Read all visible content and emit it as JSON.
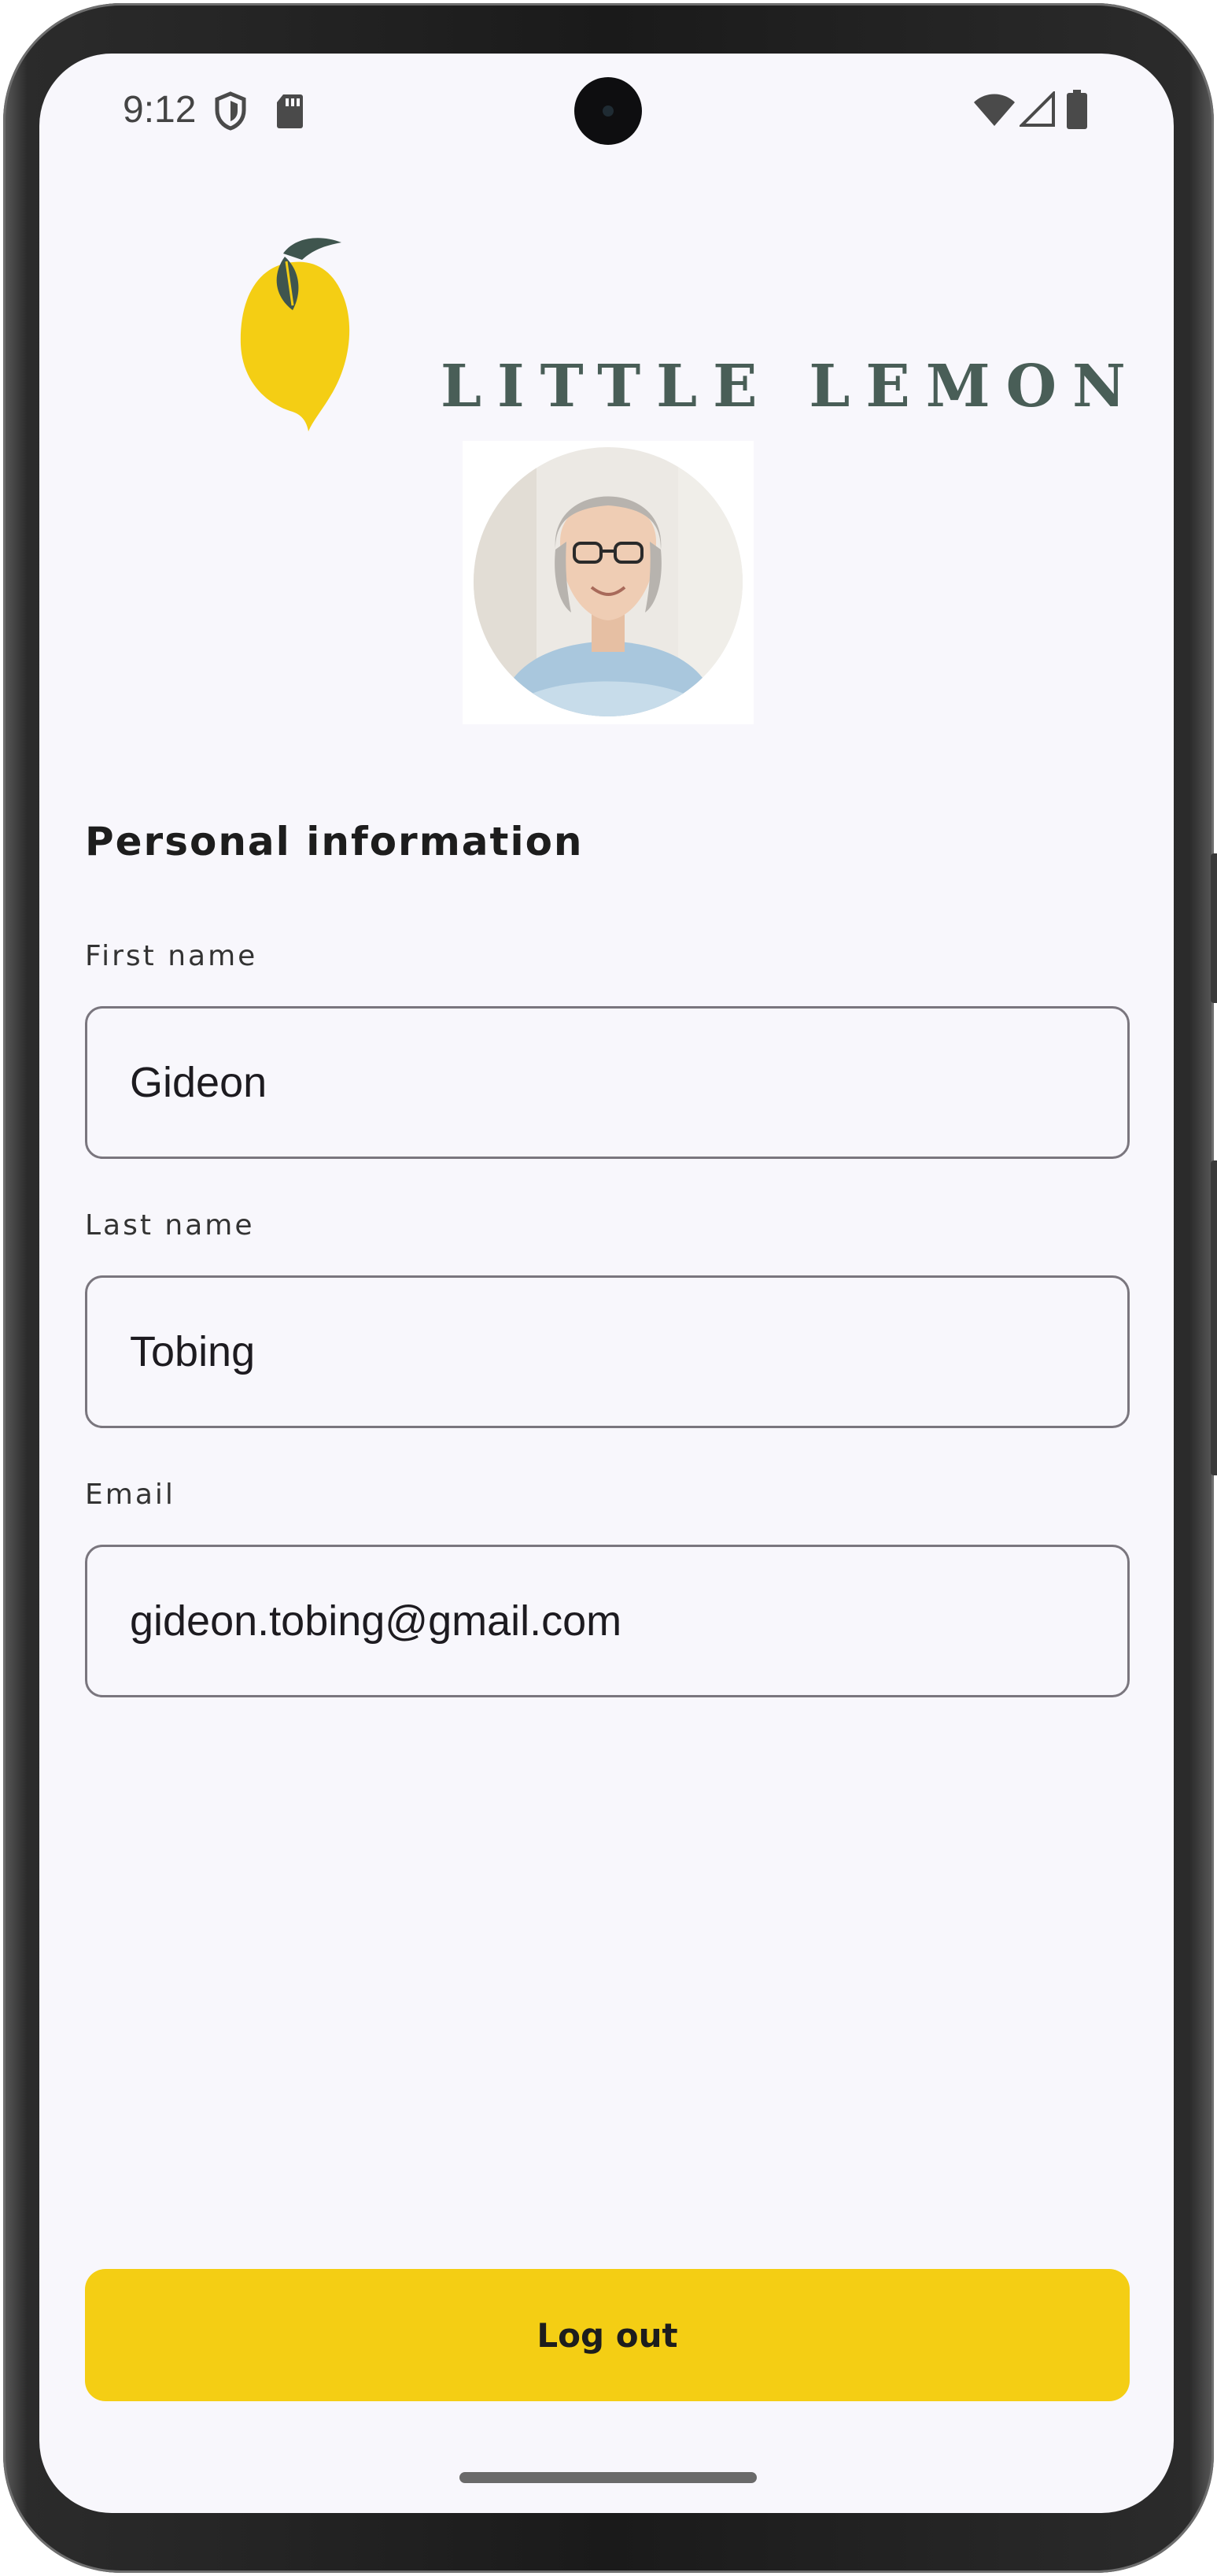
{
  "status_bar": {
    "time": "9:12",
    "left_icons": [
      "shield-icon",
      "sd-card-icon"
    ],
    "right_icons": [
      "wifi-icon",
      "cellular-signal-icon",
      "battery-icon"
    ]
  },
  "header": {
    "logo_text": "LITTLE LEMON"
  },
  "profile": {
    "section_title": "Personal information",
    "fields": [
      {
        "label": "First name",
        "value": "Gideon"
      },
      {
        "label": "Last name",
        "value": "Tobing"
      },
      {
        "label": "Email",
        "value": "gideon.tobing@gmail.com"
      }
    ]
  },
  "actions": {
    "logout_label": "Log out"
  },
  "colors": {
    "brand_green": "#495e57",
    "brand_yellow": "#f4ce14",
    "background": "#f8f7fc"
  }
}
